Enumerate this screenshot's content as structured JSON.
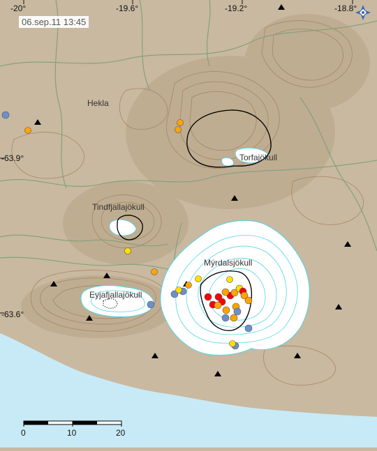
{
  "timestamp": "06.sep.11  13:45",
  "longitude_labels": [
    "-20°",
    "-19.6°",
    "-19.2°",
    "-18.8°"
  ],
  "latitude_labels": [
    "-63.9°",
    "-63.6°"
  ],
  "places": [
    "Hekla",
    "Torfajökull",
    "Tindfjallajökull",
    "Mýrdalsjökull",
    "Eyjafjallajökull"
  ],
  "scale_labels": [
    "0",
    "10",
    "20"
  ],
  "icon": "compass-star-icon",
  "colors": {
    "land": "#c8b9a0",
    "sea": "#c8eaf6",
    "glacier": "#ffffff",
    "glacier_contour": "#52d6e8",
    "topo_contour": "#a07a5a",
    "river": "#7fa07a",
    "caldera": "#000000",
    "quake_red": "#ff0000",
    "quake_orange": "#ffa500",
    "quake_yellow": "#ffe100",
    "quake_blue": "#6f8fc8"
  },
  "earthquakes": [
    {
      "age": "oldest",
      "color": "blue"
    },
    {
      "age": "old",
      "color": "orange"
    },
    {
      "age": "recent",
      "color": "yellow"
    },
    {
      "age": "newest",
      "color": "red"
    }
  ]
}
